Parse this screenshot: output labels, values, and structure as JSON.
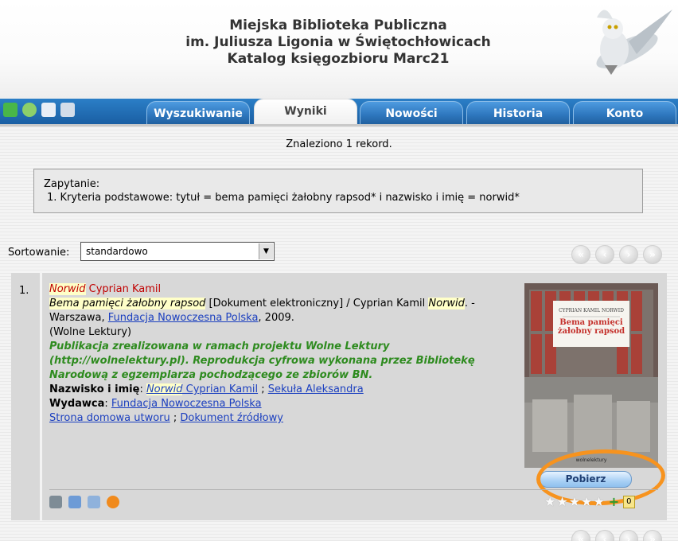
{
  "header": {
    "line1": "Miejska Biblioteka Publiczna",
    "line2": "im. Juliusza Ligonia w Świętochłowicach",
    "line3": "Katalog księgozbioru Marc21"
  },
  "nav": {
    "tabs": [
      {
        "label": "Wyszukiwanie"
      },
      {
        "label": "Wyniki"
      },
      {
        "label": "Nowości"
      },
      {
        "label": "Historia"
      },
      {
        "label": "Konto"
      }
    ],
    "active_tab": "Wyniki"
  },
  "results": {
    "found_text": "Znaleziono 1 rekord.",
    "query_label": "Zapytanie:",
    "query_line": "1. Kryteria podstawowe: tytuł = bema pamięci żałobny rapsod* i nazwisko i imię = norwid*"
  },
  "sort": {
    "label": "Sortowanie:",
    "value": "standardowo"
  },
  "record": {
    "number": "1.",
    "author_hl": "Norwid",
    "author_rest": " Cyprian Kamil",
    "title_hl": "Bema pamięci żałobny rapsod",
    "title_rest": " [Dokument elektroniczny] / Cyprian Kamil ",
    "title_author_hl": "Norwid",
    "title_tail": ". -",
    "place": "Warszawa, ",
    "publisher_link": "Fundacja Nowoczesna Polska",
    "year": ", 2009.",
    "series": "(Wolne Lektury)",
    "note": "Publikacja zrealizowana w ramach projektu Wolne Lektury (http://wolnelektury.pl). Reprodukcja cyfrowa wykonana przez Bibliotekę Narodową z egzemplarza pochodzącego ze zbiorów BN.",
    "names_label": "Nazwisko i imię",
    "names_colon": ": ",
    "name1_hl": "Norwid",
    "name1_rest": " Cyprian Kamil",
    "sep": " ; ",
    "name2": "Sekuła Aleksandra",
    "publisher_label": "Wydawca",
    "publisher_colon": ": ",
    "publisher_value": "Fundacja Nowoczesna Polska",
    "link_home": "Strona domowa utworu",
    "link_source": "Dokument źródłowy",
    "cover_author": "CYPRIAN KAMIL NORWID",
    "cover_title": "Bema pamięci żałobny rapsod",
    "cover_logo": "wolnelektury",
    "download_label": "Pobierz",
    "rating_count": "0"
  },
  "colors": {
    "nav_blue": "#1a5fa3",
    "link": "#1b3fbf",
    "green_note": "#2e8b1f",
    "highlight": "#ffffc8",
    "annotation_orange": "#f7931e"
  }
}
